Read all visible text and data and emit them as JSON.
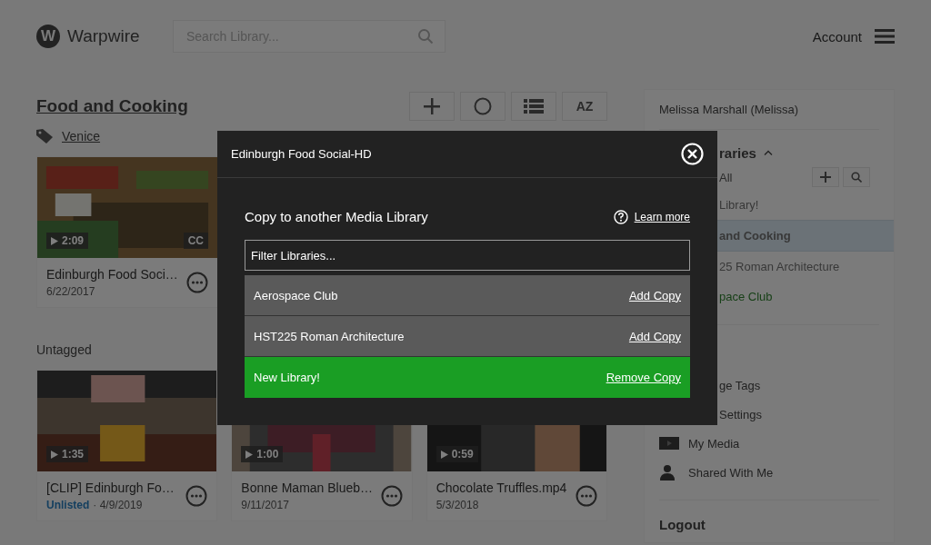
{
  "header": {
    "logo_letter": "W",
    "brand": "Warpwire",
    "search": {
      "placeholder": "Search Library..."
    },
    "account": "Account"
  },
  "library": {
    "title": "Food and Cooking",
    "toolbar": [
      {
        "kind": "add"
      },
      {
        "kind": "circle"
      },
      {
        "kind": "list"
      },
      {
        "kind": "sort",
        "label": "AZ"
      }
    ],
    "groups": [
      {
        "tag": "Venice",
        "cards": [
          {
            "duration": "2:09",
            "cc": "CC",
            "title": "Edinburgh Food Soci…",
            "date": "6/22/2017"
          }
        ]
      },
      {
        "heading": "Untagged",
        "cards": [
          {
            "duration": "1:35",
            "title": "[CLIP] Edinburgh Fo…",
            "status": "Unlisted",
            "date": "· 4/9/2019"
          },
          {
            "duration": "1:00",
            "title": "Bonne Maman Blueb…",
            "date": "9/11/2017"
          },
          {
            "duration": "0:59",
            "title": "Chocolate Truffles.mp4",
            "date": "5/3/2018"
          }
        ]
      }
    ]
  },
  "sidebar": {
    "user": "Melissa Marshall (Melissa)",
    "libraries_heading": "raries",
    "all_label": "All",
    "libraries": [
      {
        "name": "Library!",
        "selected": false,
        "color": "#383838"
      },
      {
        "name": "and Cooking",
        "selected": true,
        "color": "#383838"
      },
      {
        "name": "25 Roman Architecture",
        "selected": false,
        "color": "#383838"
      },
      {
        "name": "pace Club",
        "selected": false,
        "color": "#174017"
      }
    ],
    "menu": [
      {
        "kind": "covered",
        "label": "ge Tags"
      },
      {
        "kind": "covered",
        "label": "Settings"
      },
      {
        "kind": "media",
        "label": "My Media"
      },
      {
        "kind": "shared",
        "label": "Shared With Me"
      }
    ],
    "logout": "Logout"
  },
  "modal": {
    "title": "Edinburgh Food Social-HD",
    "heading": "Copy to another Media Library",
    "learn_more": "Learn more",
    "filter": {
      "placeholder": "Filter Libraries..."
    },
    "rows": [
      {
        "name": "Aerospace Club",
        "action": "Add Copy",
        "copied": false
      },
      {
        "name": "HST225 Roman Architecture",
        "action": "Add Copy",
        "copied": false
      },
      {
        "name": "New Library!",
        "action": "Remove Copy",
        "copied": true
      }
    ]
  }
}
